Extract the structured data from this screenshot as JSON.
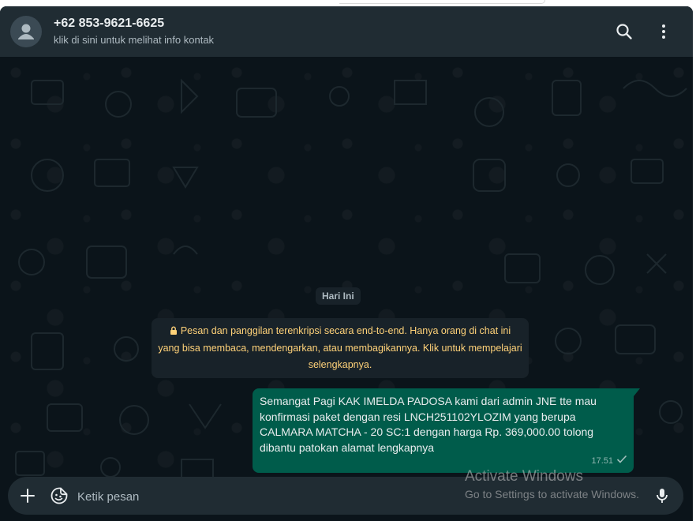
{
  "header": {
    "contact_name": "+62 853-9621-6625",
    "subtitle": "klik di sini untuk melihat info kontak",
    "avatar_icon": "default-avatar-icon",
    "search_icon": "search-icon",
    "menu_icon": "kebab-menu-icon"
  },
  "chat": {
    "date_label": "Hari Ini",
    "encryption_notice": "Pesan dan panggilan terenkripsi secara end-to-end. Hanya orang di chat ini yang bisa membaca, mendengarkan, atau membagikannya. Klik untuk mempelajari selengkapnya.",
    "encryption_icon": "lock-icon",
    "messages": [
      {
        "direction": "outgoing",
        "text": "Semangat Pagi KAK IMELDA PADOSA kami dari admin JNE tte mau konfirmasi paket dengan resi LNCH251102YLOZIM yang berupa CALMARA MATCHA - 20 SC:1 dengan harga Rp. 369,000.00 tolong dibantu patokan alamat lengkapnya",
        "time": "17.51",
        "status_icon": "single-check-icon"
      }
    ]
  },
  "composer": {
    "placeholder": "Ketik pesan",
    "attach_icon": "plus-icon",
    "sticker_icon": "sticker-icon",
    "mic_icon": "microphone-icon"
  },
  "watermark": {
    "title": "Activate Windows",
    "subtitle": "Go to Settings to activate Windows."
  },
  "colors": {
    "background": "#0b141a",
    "header": "#202c33",
    "outgoing_bubble": "#005c4b",
    "notice_text": "#ffd279"
  }
}
